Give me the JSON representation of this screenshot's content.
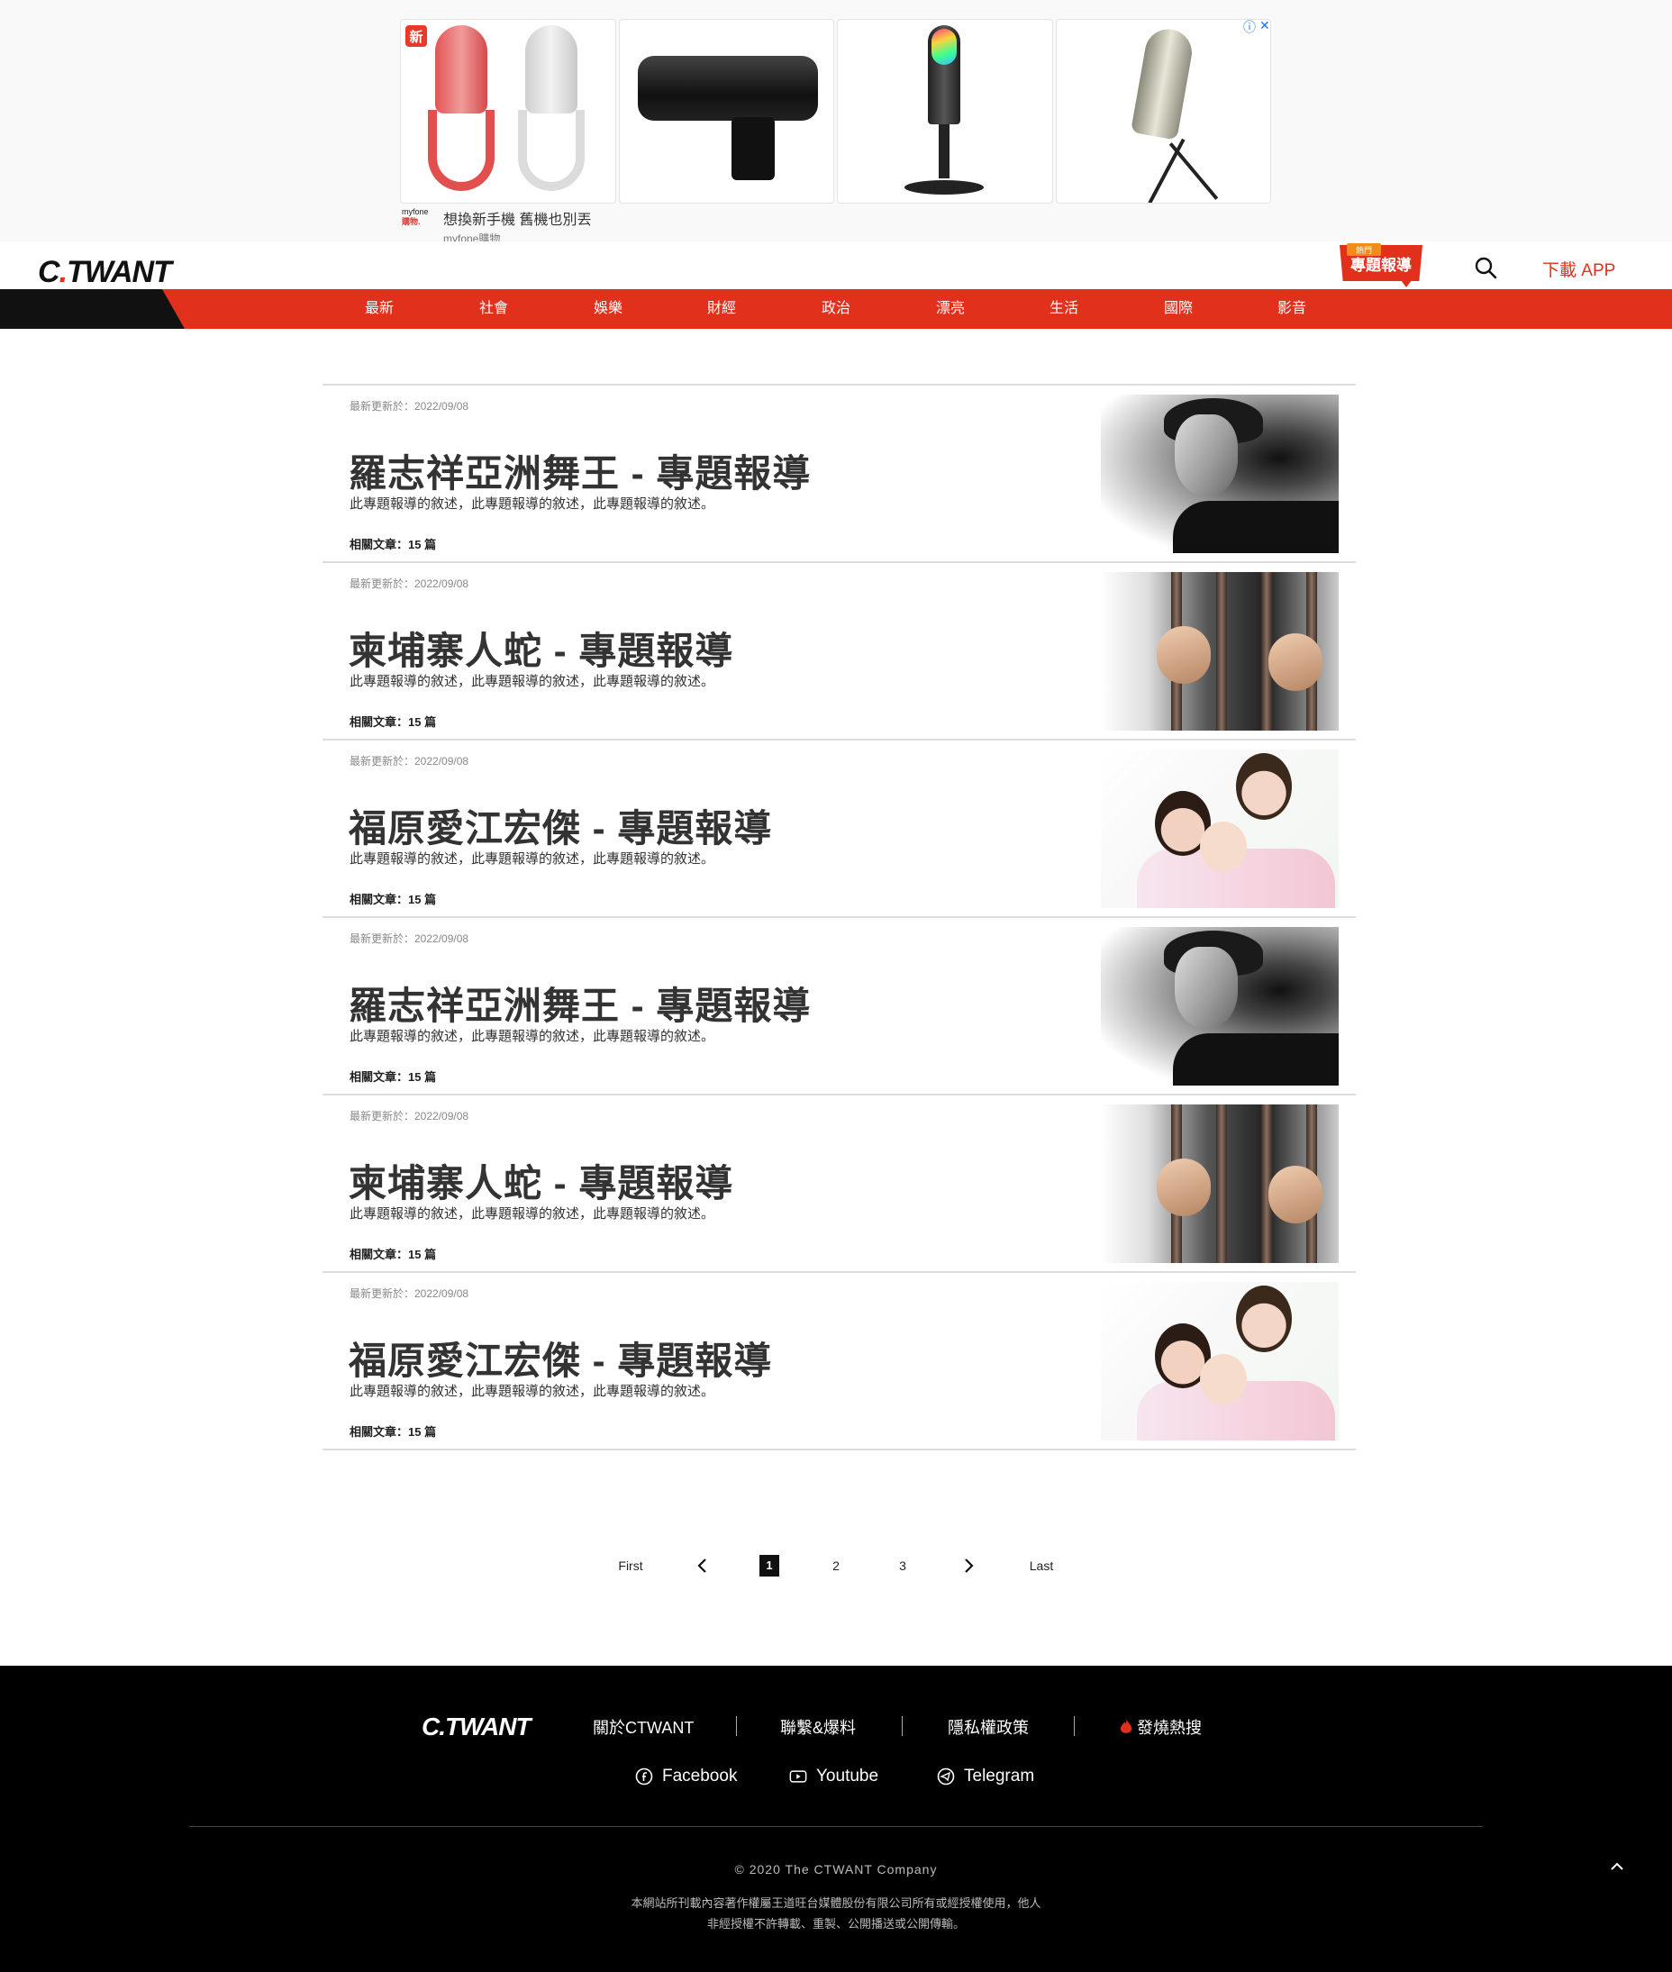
{
  "ad": {
    "badge": "新",
    "choices_icon": "info-icon",
    "close_icon": "close-icon",
    "advertiser_logo_line1": "myfone",
    "advertiser_logo_line2": "購物.",
    "headline": "想換新手機 舊機也別丟",
    "advertiser": "myfone購物"
  },
  "header": {
    "logo_c": "C",
    "logo_dot": ".",
    "logo_rest": "TWANT",
    "hot_badge_top": "熱門",
    "hot_badge": "專題報導",
    "download": "下載 APP"
  },
  "nav": {
    "items": [
      "最新",
      "社會",
      "娛樂",
      "財經",
      "政治",
      "漂亮",
      "生活",
      "國際",
      "影音"
    ]
  },
  "topics": [
    {
      "date": "最新更新於：2022/09/08",
      "title": "羅志祥亞洲舞王 - 專題報導",
      "desc": "此專題報導的敘述，此專題報導的敘述，此專題報導的敘述。",
      "count": "相關文章：15 篇",
      "image": "portrait"
    },
    {
      "date": "最新更新於：2022/09/08",
      "title": "柬埔寨人蛇 - 專題報導",
      "desc": "此專題報導的敘述，此專題報導的敘述，此專題報導的敘述。",
      "count": "相關文章：15 篇",
      "image": "jail-bars"
    },
    {
      "date": "最新更新於：2022/09/08",
      "title": "福原愛江宏傑 - 專題報導",
      "desc": "此專題報導的敘述，此專題報導的敘述，此專題報導的敘述。",
      "count": "相關文章：15 篇",
      "image": "family"
    },
    {
      "date": "最新更新於：2022/09/08",
      "title": "羅志祥亞洲舞王 - 專題報導",
      "desc": "此專題報導的敘述，此專題報導的敘述，此專題報導的敘述。",
      "count": "相關文章：15 篇",
      "image": "portrait"
    },
    {
      "date": "最新更新於：2022/09/08",
      "title": "柬埔寨人蛇 - 專題報導",
      "desc": "此專題報導的敘述，此專題報導的敘述，此專題報導的敘述。",
      "count": "相關文章：15 篇",
      "image": "jail-bars"
    },
    {
      "date": "最新更新於：2022/09/08",
      "title": "福原愛江宏傑 - 專題報導",
      "desc": "此專題報導的敘述，此專題報導的敘述，此專題報導的敘述。",
      "count": "相關文章：15 篇",
      "image": "family"
    }
  ],
  "pagination": {
    "first": "First",
    "prev_icon": "chevron-left-icon",
    "pages": [
      "1",
      "2",
      "3"
    ],
    "current": "1",
    "next_icon": "chevron-right-icon",
    "last": "Last"
  },
  "footer": {
    "logo": "C.TWANT",
    "links": [
      "關於CTWANT",
      "聯繫&爆料",
      "隱私權政策",
      "發燒熱搜"
    ],
    "hot_icon": "fire-icon",
    "social": [
      {
        "label": "Facebook",
        "icon": "facebook-icon"
      },
      {
        "label": "Youtube",
        "icon": "youtube-icon"
      },
      {
        "label": "Telegram",
        "icon": "telegram-icon"
      }
    ],
    "copyright": "© 2020 The CTWANT Company",
    "notice_line1": "本網站所刊載內容著作權屬王道旺台媒體股份有限公司所有或經授權使用，他人",
    "notice_line2": "非經授權不許轉載、重製、公開播送或公開傳輸。",
    "back_to_top_icon": "chevron-up-icon"
  },
  "colors": {
    "brand_red": "#e1301c",
    "footer_bg": "#000000",
    "nav_text": "#ffffff"
  }
}
